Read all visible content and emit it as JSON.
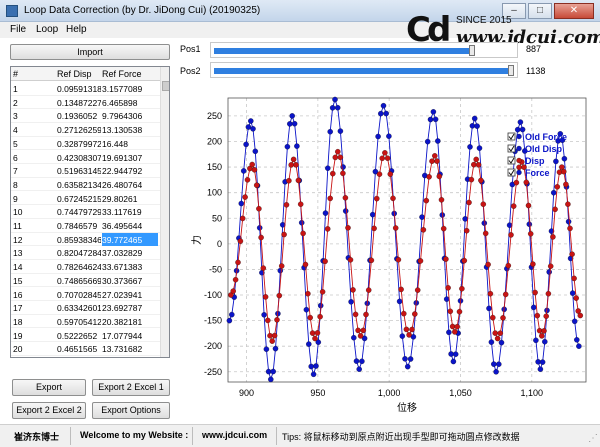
{
  "window": {
    "title": "Loop Data Correction (by Dr. JiDong Cui) (20190325)",
    "minimize": "–",
    "maximize": "□",
    "close": "✕"
  },
  "menu": [
    "File",
    "Loop",
    "Help"
  ],
  "logo": {
    "mark": "Cd",
    "since": "SINCE 2015",
    "url": "www.jdcui.com"
  },
  "import_button": "Import",
  "table": {
    "headers": [
      "#",
      "Ref Disp",
      "Ref Force"
    ],
    "selected_row": 11,
    "rows": [
      [
        "1",
        "0.09591318",
        "3.1577089"
      ],
      [
        "2",
        "0.13487227",
        "6.465898"
      ],
      [
        "3",
        "0.1936052",
        "9.7964306"
      ],
      [
        "4",
        "0.27126259",
        "13.130538"
      ],
      [
        "5",
        "0.32879972",
        "16.448"
      ],
      [
        "6",
        "0.42308307",
        "19.691307"
      ],
      [
        "7",
        "0.51963145",
        "22.944792"
      ],
      [
        "8",
        "0.63582134",
        "26.480764"
      ],
      [
        "9",
        "0.67245215",
        "29.80261"
      ],
      [
        "10",
        "0.74479729",
        "33.117619"
      ],
      [
        "11",
        "0.7846579",
        "36.495644"
      ],
      [
        "12",
        "0.85938346",
        "39.772465"
      ],
      [
        "13",
        "0.82047284",
        "37.032829"
      ],
      [
        "14",
        "0.78264624",
        "33.671383"
      ],
      [
        "15",
        "0.74865669",
        "30.373667"
      ],
      [
        "16",
        "0.70702845",
        "27.023941"
      ],
      [
        "17",
        "0.63342601",
        "23.692787"
      ],
      [
        "18",
        "0.59705412",
        "20.382181"
      ],
      [
        "19",
        "0.5222652",
        "17.077944"
      ],
      [
        "20",
        "0.4651565",
        "13.731682"
      ]
    ]
  },
  "buttons": {
    "export": "Export",
    "export_excel1": "Export 2 Excel 1",
    "export_excel2": "Export 2 Excel 2",
    "export_options": "Export Options"
  },
  "sliders": [
    {
      "label": "Pos1",
      "value": "887",
      "fraction": 0.86
    },
    {
      "label": "Pos2",
      "value": "1138",
      "fraction": 0.99
    }
  ],
  "chart_data": {
    "type": "line",
    "xlabel": "位移",
    "ylabel": "力",
    "xlim": [
      887,
      1138
    ],
    "ylim": [
      -270,
      285
    ],
    "xticks": [
      900,
      950,
      1000,
      1050,
      1100
    ],
    "xtick_labels": [
      "900",
      "950",
      "1,000",
      "1,050",
      "1,100"
    ],
    "yticks": [
      250,
      200,
      150,
      100,
      50,
      0,
      -50,
      -100,
      -150,
      -200,
      -250
    ],
    "grid": true,
    "legend_position": "right",
    "legend": [
      "Old Force",
      "Old Disp",
      "Disp",
      "Force"
    ],
    "series": [
      {
        "name": "Force",
        "color": "#0b14c8",
        "amplitude": 195,
        "peaks": [
          [
            903,
            240
          ],
          [
            932,
            250
          ],
          [
            962,
            282
          ],
          [
            996,
            270
          ],
          [
            1031,
            258
          ],
          [
            1060,
            245
          ],
          [
            1092,
            238
          ],
          [
            1120,
            215
          ]
        ],
        "troughs": [
          [
            888,
            -150
          ],
          [
            917,
            -265
          ],
          [
            947,
            -255
          ],
          [
            979,
            -245
          ],
          [
            1013,
            -240
          ],
          [
            1045,
            -230
          ],
          [
            1075,
            -250
          ],
          [
            1106,
            -245
          ],
          [
            1133,
            -200
          ]
        ]
      },
      {
        "name": "Disp",
        "color": "#c81414",
        "amplitude": 150,
        "peaks": [
          [
            904,
            155
          ],
          [
            933,
            165
          ],
          [
            964,
            180
          ],
          [
            997,
            178
          ],
          [
            1032,
            172
          ],
          [
            1061,
            165
          ],
          [
            1093,
            160
          ],
          [
            1121,
            150
          ]
        ],
        "troughs": [
          [
            889,
            -100
          ],
          [
            918,
            -190
          ],
          [
            948,
            -185
          ],
          [
            980,
            -180
          ],
          [
            1014,
            -178
          ],
          [
            1046,
            -172
          ],
          [
            1076,
            -185
          ],
          [
            1107,
            -180
          ],
          [
            1134,
            -140
          ]
        ]
      }
    ]
  },
  "status": {
    "author": "崔济东博士",
    "welcome": "Welcome to my Website :",
    "site": "www.jdcui.com",
    "tips": "Tips: 将鼠标移动到原点附近出现手型即可拖动圆点修改数据"
  },
  "colors": {
    "accent": "#2f7fe0",
    "selection": "#3399ff",
    "force": "#0b14c8",
    "disp": "#c81414"
  }
}
